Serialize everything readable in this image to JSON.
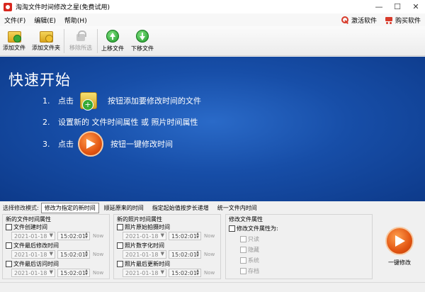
{
  "window": {
    "title": "淘淘文件时间修改之星(免费试用)",
    "minimize": "—",
    "maximize": "☐",
    "close": "✕"
  },
  "menu": {
    "file": "文件(F)",
    "edit": "编辑(E)",
    "help": "帮助(H)",
    "activate": "激活软件",
    "buy": "购买软件"
  },
  "toolbar": {
    "add_file": "添加文件",
    "add_folder": "添加文件夹",
    "remove_selected": "移除所选",
    "move_up": "上移文件",
    "move_down": "下移文件"
  },
  "quickstart": {
    "title": "快速开始",
    "step1_num": "1.",
    "step1_pre": "点击",
    "step1_post": "按钮添加要修改时间的文件",
    "step2_num": "2.",
    "step2_text": "设置新的 文件时间属性 或 照片时间属性",
    "step3_num": "3.",
    "step3_pre": "点击",
    "step3_post": "按钮一键修改时间"
  },
  "mode": {
    "label": "选择修改模式:",
    "tabs": [
      "修改为指定的新时间",
      "顺延原来的时间",
      "指定起始值按步长递增",
      "统一文件内时间"
    ],
    "active_index": 0
  },
  "file_time": {
    "title": "新的文件时间属性",
    "fields": [
      {
        "label": "文件创建时间",
        "date": "2021-01-18",
        "time": "15:02:01",
        "now": "Now"
      },
      {
        "label": "文件最后修改时间",
        "date": "2021-01-18",
        "time": "15:02:01",
        "now": "Now"
      },
      {
        "label": "文件最后访问时间",
        "date": "2021-01-18",
        "time": "15:02:01",
        "now": "Now"
      }
    ]
  },
  "photo_time": {
    "title": "新的照片时间属性",
    "fields": [
      {
        "label": "照片原始拍摄时间",
        "date": "2021-01-18",
        "time": "15:02:01",
        "now": "Now"
      },
      {
        "label": "照片数字化时间",
        "date": "2021-01-18",
        "time": "15:02:01",
        "now": "Now"
      },
      {
        "label": "照片最后更新时间",
        "date": "2021-01-18",
        "time": "15:02:01",
        "now": "Now"
      }
    ]
  },
  "file_attr": {
    "title": "修改文件属性",
    "toggle": "修改文件属性为:",
    "items": [
      "只读",
      "隐藏",
      "系统",
      "存档"
    ]
  },
  "action": {
    "one_key": "一键修改"
  }
}
